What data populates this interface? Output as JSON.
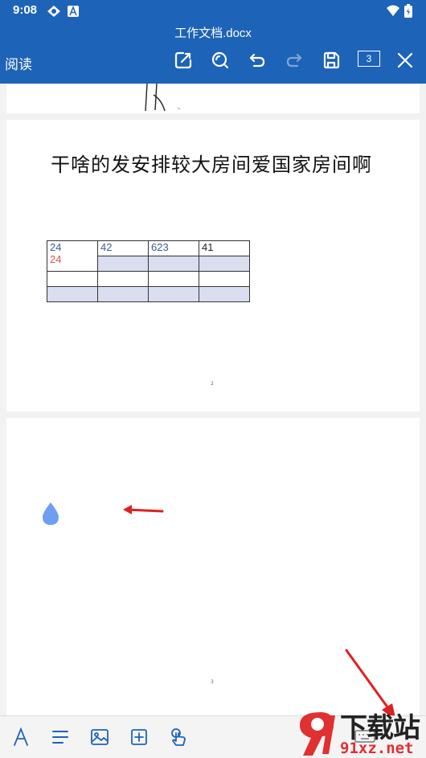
{
  "status": {
    "time": "9:08"
  },
  "header": {
    "doc_title": "工作文档.docx",
    "read_label": "阅读",
    "page_count": "3"
  },
  "doc": {
    "heading": "干啥的发安排较大房间爱国家房间啊",
    "table": {
      "rows": [
        [
          "24",
          "42",
          "623",
          "41"
        ],
        [
          "24",
          "",
          "",
          ""
        ],
        [
          "",
          "",
          "",
          ""
        ],
        [
          "",
          "",
          "",
          ""
        ]
      ]
    },
    "page2_number": "2",
    "page3_number": "3"
  },
  "watermark": {
    "brand_text": "下载站",
    "site_text": "91xz.net"
  },
  "colors": {
    "primary": "#1d63b7",
    "text_blue": "#3a5aa0",
    "text_red": "#d9534f",
    "table_shade": "#d9dff0",
    "arrow_red": "#e02020",
    "drop_blue": "#6f9ef0"
  },
  "icons": [
    "edit-icon",
    "search-icon",
    "undo-icon",
    "redo-icon",
    "save-icon",
    "close-icon",
    "font-icon",
    "align-icon",
    "image-icon",
    "insert-icon",
    "touch-icon",
    "drop-icon"
  ]
}
